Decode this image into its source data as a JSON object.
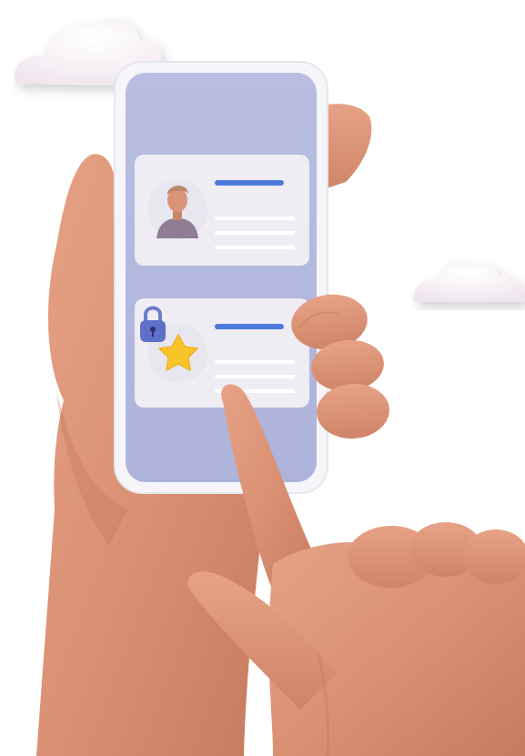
{
  "scene": {
    "background": "#ffffff",
    "phone_frame_color": "#f4f4f8",
    "phone_screen_color": "#b4b9de",
    "skin_color": "#d98f72",
    "skin_shadow_color": "#b86f56",
    "card_color": "#efedf3",
    "accent_line_color": "#4f79db",
    "placeholder_line_color": "#ffffff",
    "cloud_color": "#f7f1f6",
    "lock_color": "#5f70c9",
    "star_color": "#f7c52a"
  },
  "cards": [
    {
      "type": "profile",
      "avatar_icon": "person-avatar-icon",
      "has_accent_line": true,
      "placeholder_lines": 3
    },
    {
      "type": "locked-favorite",
      "avatar_icon": "star-icon",
      "badge_icon": "padlock-icon",
      "has_accent_line": true,
      "placeholder_lines": 3
    }
  ],
  "icons": {
    "left_cloud": "cloud-icon",
    "right_cloud": "cloud-icon",
    "lock": "padlock-icon",
    "star": "star-icon",
    "person": "person-avatar-icon"
  }
}
